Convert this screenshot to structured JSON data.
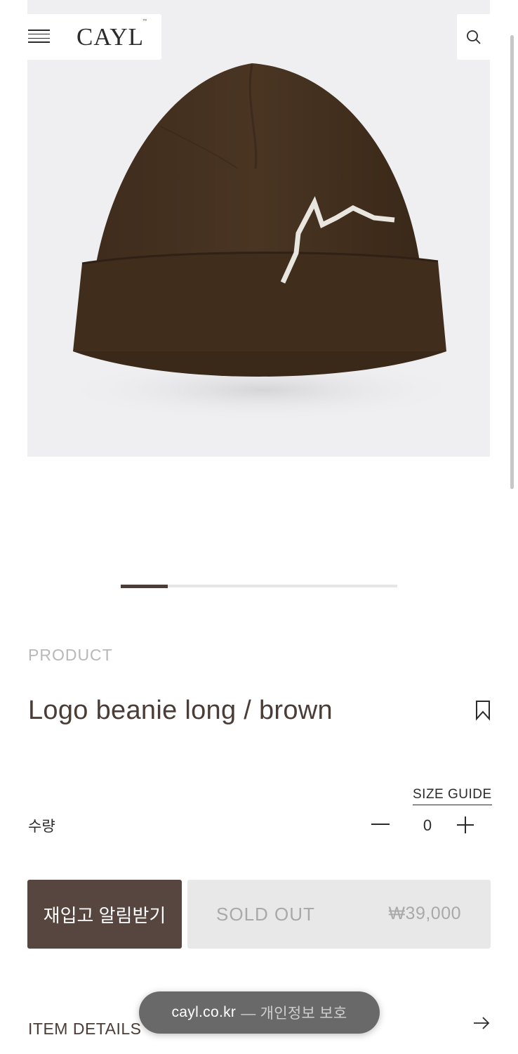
{
  "header": {
    "brand": "CAYL",
    "brand_mark": "™",
    "menu_icon": "hamburger-menu-icon",
    "search_icon": "search-icon"
  },
  "gallery": {
    "image": "brown-beanie-with-white-mountain-logo",
    "current_slide_fraction": 0.17
  },
  "product": {
    "category": "PRODUCT",
    "name": "Logo beanie long / brown",
    "bookmark_icon": "bookmark-icon"
  },
  "options": {
    "size_guide_label": "SIZE GUIDE",
    "quantity_label": "수량",
    "quantity_value": "0"
  },
  "actions": {
    "restock_label": "재입고 알림받기",
    "soldout_label": "SOLD OUT",
    "price": "₩39,000"
  },
  "details": {
    "label": "ITEM DETAILS"
  },
  "privacy_banner": {
    "domain": "cayl.co.kr",
    "text": "— 개인정보 보호"
  },
  "colors": {
    "brand_brown": "#574540",
    "text_brown": "#4a3c36",
    "disabled_gray": "#e8e8e8"
  }
}
